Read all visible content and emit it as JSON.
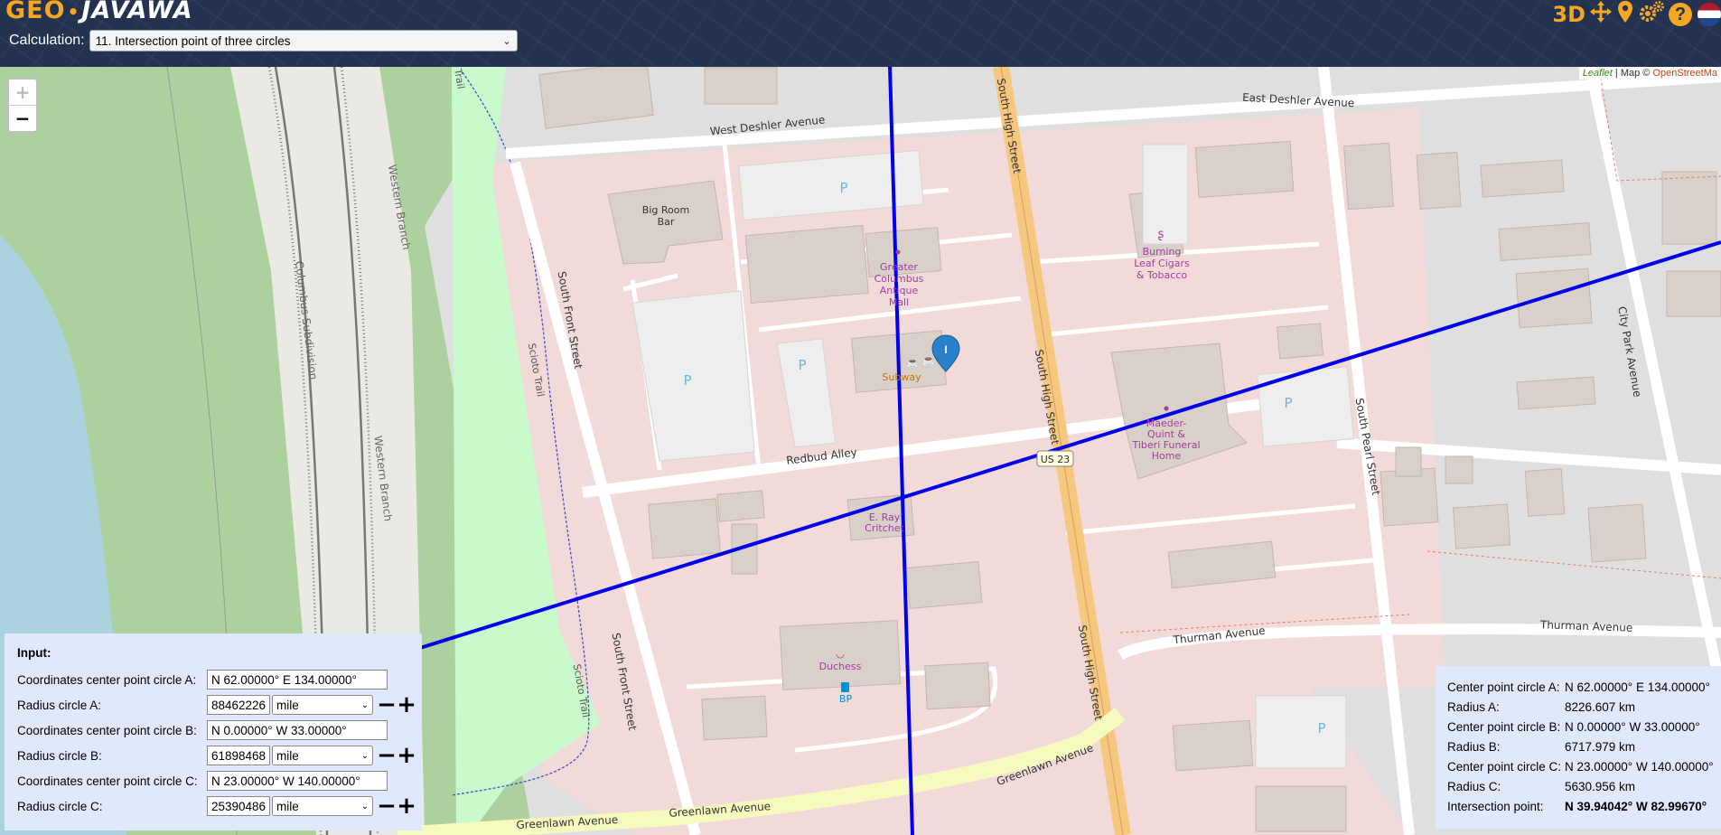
{
  "header": {
    "logo_geo": "GEO",
    "logo_dot": "•",
    "logo_javawa": "JAVAWA",
    "calculation_label": "Calculation:",
    "calculation_selected": "11. Intersection point of three circles",
    "icons": [
      "3d-icon",
      "move-arrows-icon",
      "location-pin-icon",
      "settings-gears-icon",
      "help-icon",
      "flag-nl-icon"
    ],
    "icon_3d_label": "3D",
    "help_label": "?"
  },
  "map": {
    "zoom_in": "+",
    "zoom_out": "−",
    "attribution_leaflet": "Leaflet",
    "attribution_text": "| Map ©",
    "attribution_osm": "OpenStreetMa",
    "street_labels": {
      "west_deshler": "West Deshler Avenue",
      "east_deshler": "East Deshler Avenue",
      "south_high_1": "South High Street",
      "south_high_2": "South High Street",
      "south_high_3": "South High Street",
      "south_front_1": "South Front Street",
      "south_front_2": "South Front Street",
      "redbud": "Redbud Alley",
      "thurman_1": "Thurman Avenue",
      "thurman_2": "Thurman Avenue",
      "greenlawn_1": "Greenlawn Avenue",
      "greenlawn_2": "Greenlawn Avenue",
      "greenlawn_3": "Greenlawn Avenue",
      "south_pearl": "South Pearl Street",
      "city_park": "City Park Avenue",
      "scioto_trail_1": "Scioto Trail",
      "scioto_trail_2": "Scioto Trail",
      "western_branch_1": "Western Branch",
      "western_branch_2": "Western Branch",
      "columbus_sub": "Columbus Subdivision",
      "us23": "US 23",
      "trail_top": "Trail"
    },
    "poi_labels": {
      "big_room_1": "Big Room",
      "big_room_2": "Bar",
      "antique_1": "Greater",
      "antique_2": "Columbus",
      "antique_3": "Antique",
      "antique_4": "Mall",
      "subway": "Subway",
      "burning_1": "Burning",
      "burning_2": "Leaf Cigars",
      "burning_3": "& Tobacco",
      "funeral_1": "Maeder-",
      "funeral_2": "Quint &",
      "funeral_3": "Tiberi Funeral",
      "funeral_4": "Home",
      "eray_1": "E. Ray",
      "eray_2": "Critchet",
      "duchess": "Duchess",
      "bp": "BP",
      "parking": "P",
      "marker_label": "I"
    }
  },
  "input_panel": {
    "title": "Input:",
    "rows": [
      {
        "label": "Coordinates center point circle A:",
        "value": "N 62.00000° E 134.00000°"
      },
      {
        "label": "Radius circle A:",
        "value": "88462226",
        "unit": "mile"
      },
      {
        "label": "Coordinates center point circle B:",
        "value": "N 0.00000° W 33.00000°"
      },
      {
        "label": "Radius circle B:",
        "value": "61898468",
        "unit": "mile"
      },
      {
        "label": "Coordinates center point circle C:",
        "value": "N 23.00000° W 140.00000°"
      },
      {
        "label": "Radius circle C:",
        "value": "25390486",
        "unit": "mile"
      }
    ],
    "minus": "−",
    "plus": "+"
  },
  "result_panel": {
    "rows": [
      {
        "label": "Center point circle A:",
        "value": "N 62.00000° E 134.00000°"
      },
      {
        "label": "Radius A:",
        "value": "8226.607 km"
      },
      {
        "label": "Center point circle B:",
        "value": "N 0.00000° W 33.00000°"
      },
      {
        "label": "Radius B:",
        "value": "6717.979 km"
      },
      {
        "label": "Center point circle C:",
        "value": "N 23.00000° W 140.00000°"
      },
      {
        "label": "Radius C:",
        "value": "5630.956 km"
      },
      {
        "label": "Intersection point:",
        "value": "N 39.94042° W 82.99670°"
      }
    ]
  },
  "colors": {
    "header_bg": "#22324f",
    "accent": "#f5a623",
    "panel_bg": "#dfe9fb",
    "circle_line": "#0000ee",
    "marker": "#2a81cb"
  }
}
